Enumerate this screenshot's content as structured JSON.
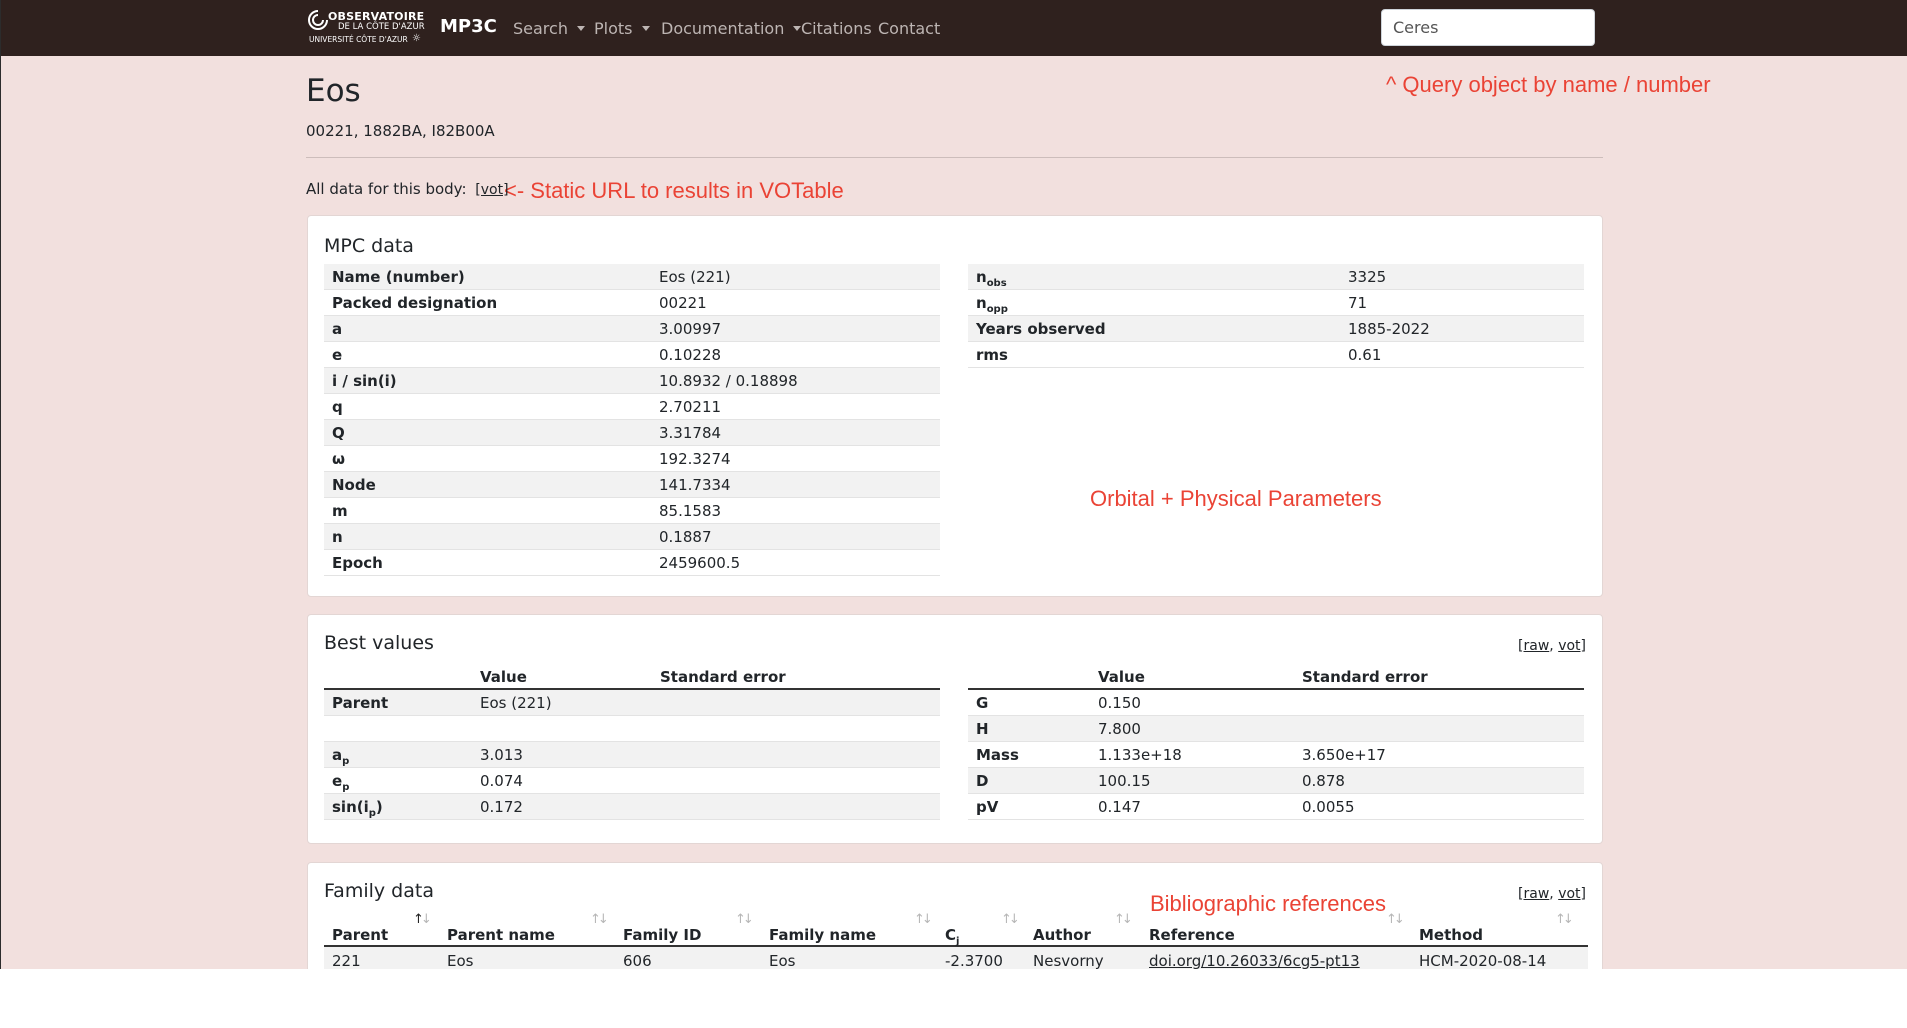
{
  "navbar": {
    "logo_line1": "OBSERVATOIRE",
    "logo_line2": "DE LA CÔTE D'AZUR",
    "logo_line3": "UNIVERSITÉ CÔTE D'AZUR",
    "brand": "MP3C",
    "items": [
      "Search",
      "Plots",
      "Documentation",
      "Citations",
      "Contact"
    ],
    "search_value": "Ceres"
  },
  "annotations": {
    "query": "^ Query object by name / number",
    "static_url": "<- Static URL to results in VOTable",
    "orbital": "Orbital + Physical Parameters",
    "biblio": "Bibliographic references"
  },
  "header": {
    "title": "Eos",
    "designations": "00221, 1882BA, I82B00A",
    "all_data_label": "All data for this body:",
    "vot_link": "[vot]"
  },
  "mpc": {
    "title": "MPC data",
    "left": [
      {
        "k": "Name (number)",
        "v": "Eos (221)"
      },
      {
        "k": "Packed designation",
        "v": "00221"
      },
      {
        "k": "a",
        "v": "3.00997"
      },
      {
        "k": "e",
        "v": "0.10228"
      },
      {
        "k": "i / sin(i)",
        "v": "10.8932 / 0.18898"
      },
      {
        "k": "q",
        "v": "2.70211"
      },
      {
        "k": "Q",
        "v": "3.31784"
      },
      {
        "k": "ω",
        "v": "192.3274"
      },
      {
        "k": "Node",
        "v": "141.7334"
      },
      {
        "k": "m",
        "v": "85.1583"
      },
      {
        "k": "n",
        "v": "0.1887"
      },
      {
        "k": "Epoch",
        "v": "2459600.5"
      }
    ],
    "right": [
      {
        "k": "n",
        "sub": "obs",
        "v": "3325"
      },
      {
        "k": "n",
        "sub": "opp",
        "v": "71"
      },
      {
        "k": "Years observed",
        "v": "1885-2022"
      },
      {
        "k": "rms",
        "v": "0.61"
      }
    ]
  },
  "best": {
    "title": "Best values",
    "links": {
      "open": "[",
      "raw": "raw",
      "sep": ", ",
      "vot": "vot",
      "close": "]"
    },
    "col_value": "Value",
    "col_se": "Standard error",
    "left": [
      {
        "k": "Parent",
        "v": "Eos (221)",
        "se": ""
      },
      {
        "k": "",
        "v": "",
        "se": ""
      },
      {
        "k": "a",
        "sub": "p",
        "v": "3.013",
        "se": ""
      },
      {
        "k": "e",
        "sub": "p",
        "v": "0.074",
        "se": ""
      },
      {
        "k": "sin(i",
        "sub": "p",
        "tail": ")",
        "v": "0.172",
        "se": ""
      }
    ],
    "right": [
      {
        "k": "G",
        "v": "0.150",
        "se": ""
      },
      {
        "k": "H",
        "v": "7.800",
        "se": ""
      },
      {
        "k": "Mass",
        "v": "1.133e+18",
        "se": "3.650e+17"
      },
      {
        "k": "D",
        "v": "100.15",
        "se": "0.878"
      },
      {
        "k": "pV",
        "v": "0.147",
        "se": "0.0055"
      }
    ]
  },
  "family": {
    "title": "Family data",
    "links": {
      "open": "[",
      "raw": "raw",
      "sep": ", ",
      "vot": "vot",
      "close": "]"
    },
    "headers": [
      "Parent",
      "Parent name",
      "Family ID",
      "Family name",
      "C",
      "Author",
      "Reference",
      "Method"
    ],
    "c_sub": "j",
    "rows": [
      [
        "221",
        "Eos",
        "606",
        "Eos",
        "-2.3700",
        "Nesvorny",
        "doi.org/10.26033/6cg5-pt13",
        "HCM-2020-08-14"
      ]
    ]
  }
}
